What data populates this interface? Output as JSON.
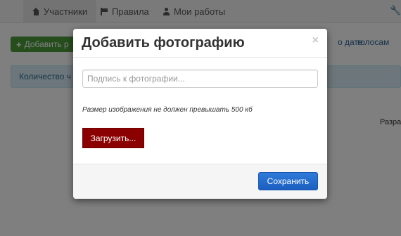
{
  "nav": {
    "tabs": [
      {
        "label": "Участники",
        "icon": "home-icon"
      },
      {
        "label": "Правила",
        "icon": "flag-icon"
      },
      {
        "label": "Мои работы",
        "icon": "user-icon"
      }
    ],
    "settings_icon": "wrench-icon"
  },
  "background": {
    "add_button_label": "Добавить р",
    "sort_date": "о дате",
    "sort_votes": "голосам",
    "count_label": "Количество ч",
    "side_text": "Разра"
  },
  "modal": {
    "title": "Добавить фотографию",
    "close_symbol": "×",
    "caption_placeholder": "Подпись к фотографии...",
    "size_note": "Размер изображения не должен превышать 500 кб",
    "upload_label": "Загрузить...",
    "save_label": "Сохранить"
  },
  "colors": {
    "upload_button": "#8b0000",
    "save_button": "#1b5fc1",
    "add_button": "#4d9c3a"
  }
}
